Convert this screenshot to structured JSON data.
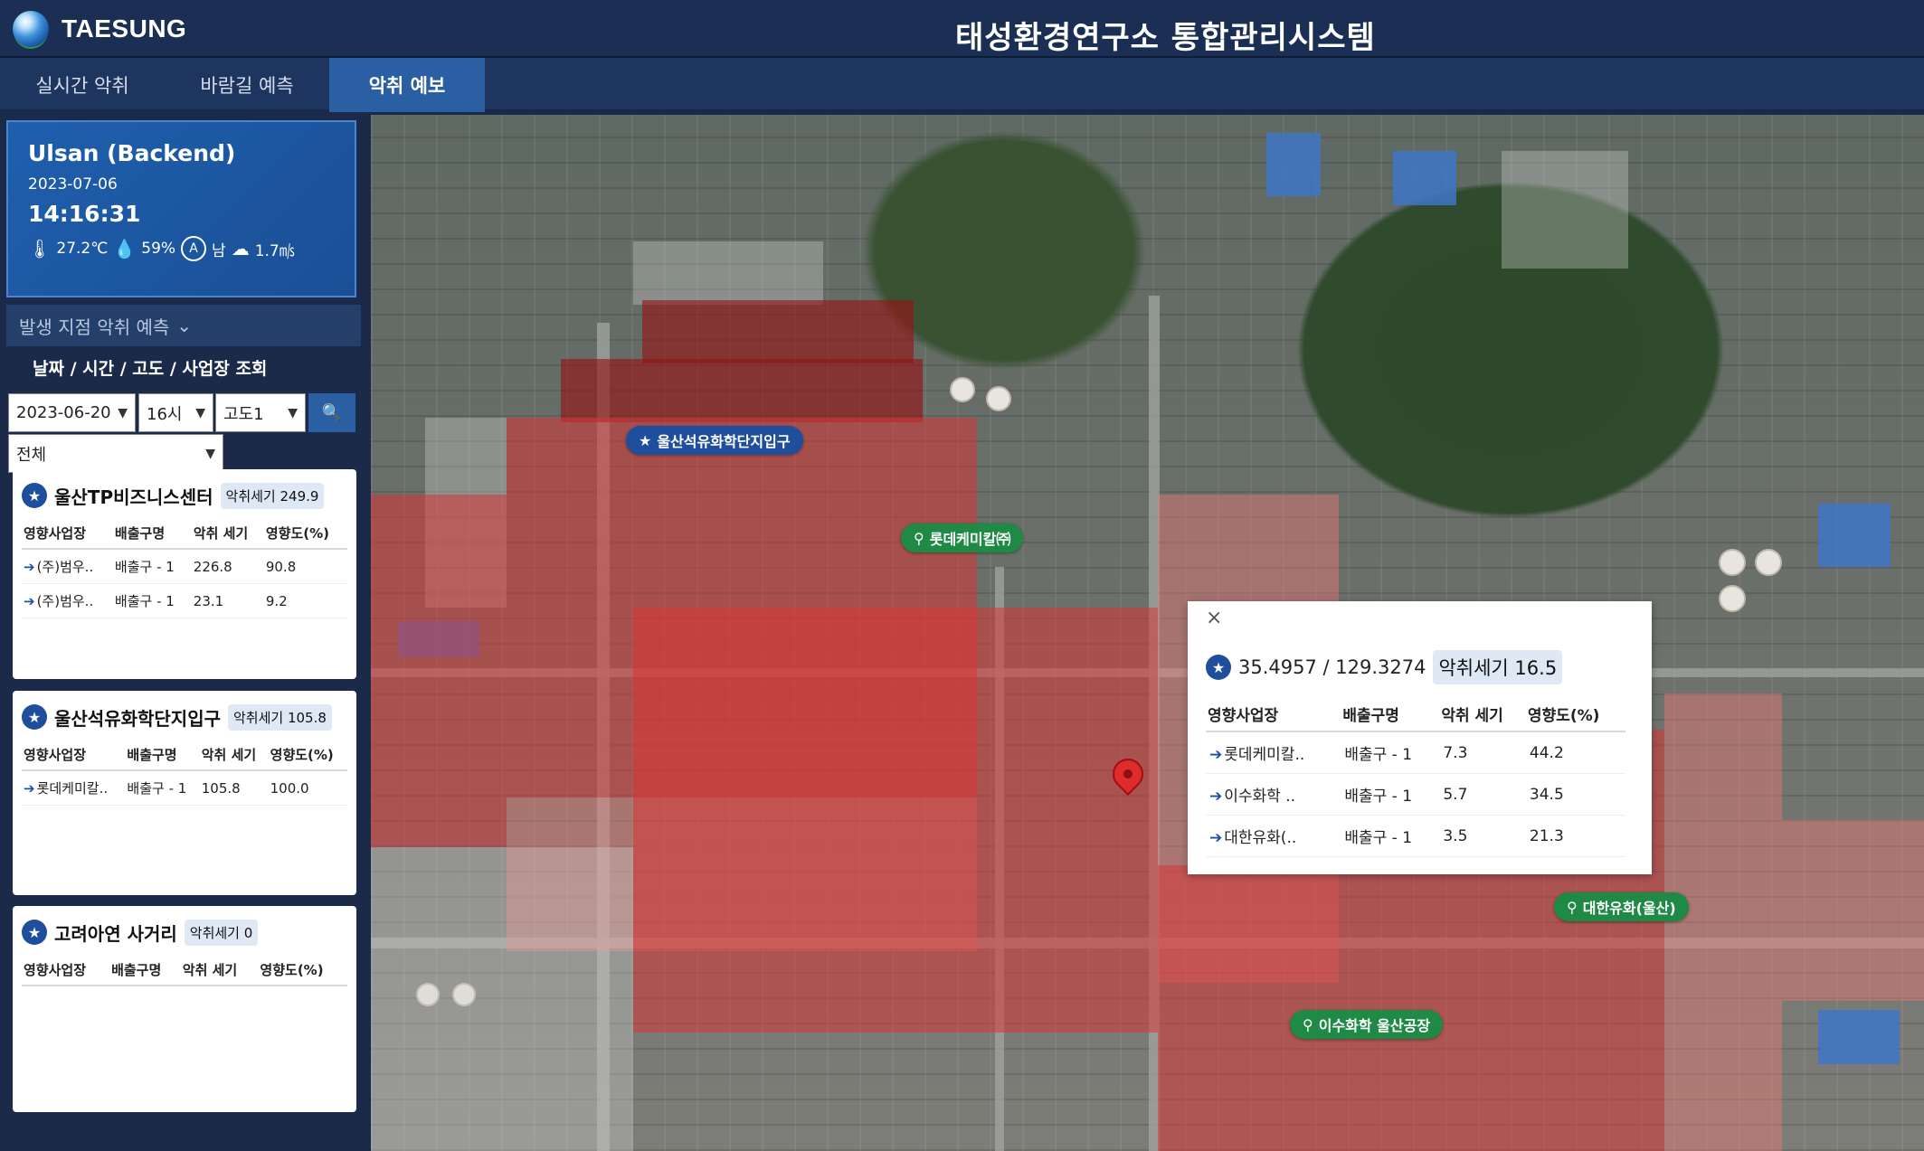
{
  "header": {
    "brand": "TAESUNG",
    "title": "태성환경연구소 통합관리시스템"
  },
  "tabs": [
    {
      "label": "실시간 악취"
    },
    {
      "label": "바람길 예측"
    },
    {
      "label": "악취 예보"
    }
  ],
  "location": {
    "name": "Ulsan (Backend)",
    "date": "2023-07-06",
    "time": "14:16:31",
    "temperature": "27.2℃",
    "humidity": "59%",
    "wind_dir": "남",
    "wind_speed": "1.7㎧"
  },
  "sidebar": {
    "section_title": "발생 지점 악취 예측",
    "query_label": "날짜 / 시간 / 고도 / 사업장 조회",
    "date_select": "2023-06-20",
    "hour_select": "16시",
    "altitude_select": "고도1",
    "business_select": "전체"
  },
  "table_headers": [
    "영향사업장",
    "배출구명",
    "악취 세기",
    "영향도(%)"
  ],
  "cards": [
    {
      "title": "울산TP비즈니스센터",
      "strength": "악취세기 249.9",
      "rows": [
        [
          "(주)범우..",
          "배출구 - 1",
          "226.8",
          "90.8"
        ],
        [
          "(주)범우..",
          "배출구 - 1",
          "23.1",
          "9.2"
        ]
      ]
    },
    {
      "title": "울산석유화학단지입구",
      "strength": "악취세기 105.8",
      "rows": [
        [
          "롯데케미칼..",
          "배출구 - 1",
          "105.8",
          "100.0"
        ]
      ]
    },
    {
      "title": "고려아연 사거리",
      "strength": "악취세기 0",
      "rows": []
    }
  ],
  "map": {
    "labels": {
      "site_entrance": "울산석유화학단지입구",
      "lotte": "롯데케미칼㈜",
      "daehan": "대한유화(울산)",
      "isu": "이수화학 울산공장"
    },
    "popup": {
      "close": "×",
      "coord": "35.4957 / 129.3274",
      "strength": "악취세기 16.5",
      "rows": [
        [
          "롯데케미칼..",
          "배출구 - 1",
          "7.3",
          "44.2"
        ],
        [
          "이수화학 ..",
          "배출구 - 1",
          "5.7",
          "34.5"
        ],
        [
          "대한유화(..",
          "배출구 - 1",
          "3.5",
          "21.3"
        ]
      ]
    }
  },
  "icons": {
    "star": "star-icon",
    "pin": "location-pin-icon",
    "search": "search-icon",
    "thermometer": "thermometer-icon",
    "droplet": "droplet-icon",
    "compass": "compass-icon",
    "wind": "wind-icon",
    "link": "link-arrow-icon"
  }
}
